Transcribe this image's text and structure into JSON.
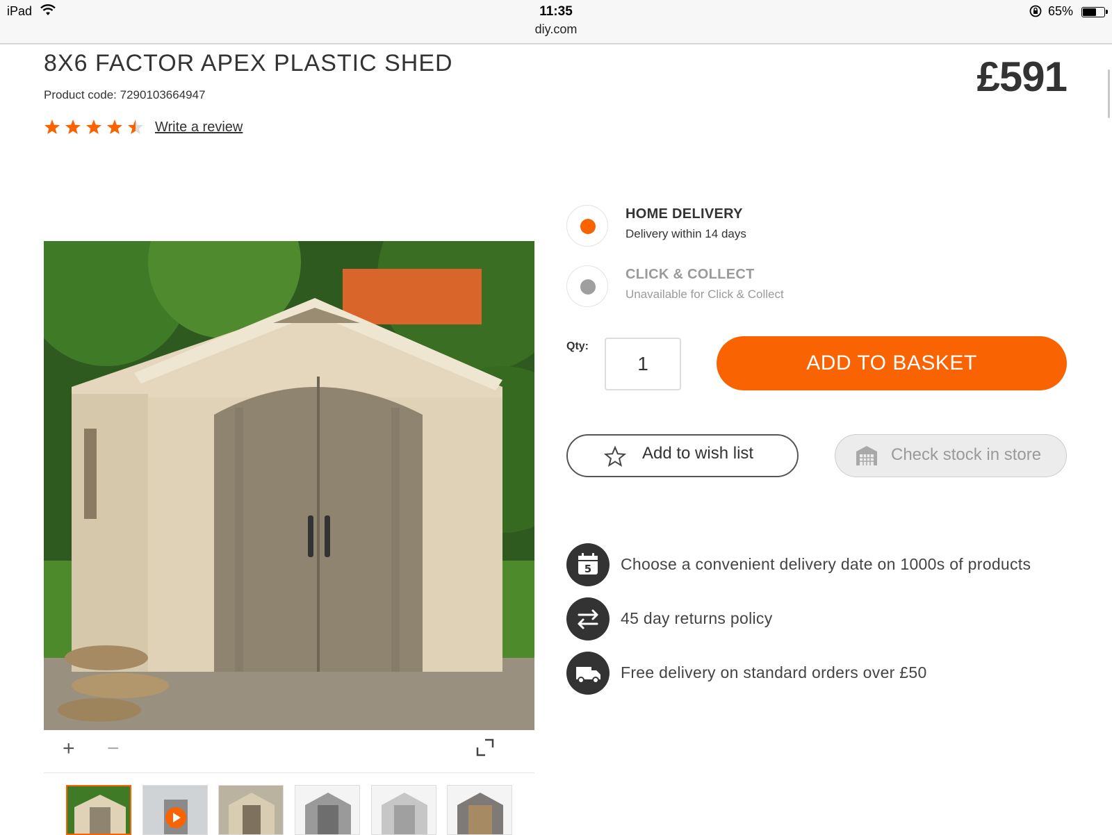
{
  "status_bar": {
    "device": "iPad",
    "time": "11:35",
    "url": "diy.com",
    "battery": "65%"
  },
  "product": {
    "title": "8X6 FACTOR APEX PLASTIC SHED",
    "code_label": "Product code:  7290103664947",
    "rating": 4.5,
    "rating_max": 5,
    "write_review": "Write a review",
    "price": "£591"
  },
  "delivery": {
    "home": {
      "title": "HOME DELIVERY",
      "subtitle": "Delivery within 14 days",
      "selected": true
    },
    "collect": {
      "title": "CLICK & COLLECT",
      "subtitle": "Unavailable for Click & Collect",
      "selected": false
    }
  },
  "purchase": {
    "qty_label": "Qty:",
    "qty_value": "1",
    "add_to_basket": "ADD TO BASKET",
    "wish_list": "Add to wish list",
    "check_stock": "Check stock in store"
  },
  "benefits": [
    {
      "icon": "calendar-icon",
      "calendar_day": "5",
      "text": "Choose a convenient delivery date on 1000s of products"
    },
    {
      "icon": "returns-arrows-icon",
      "text": "45 day returns policy"
    },
    {
      "icon": "delivery-van-icon",
      "text": "Free delivery on standard orders over £50"
    }
  ],
  "gallery": {
    "zoom_in": "+",
    "zoom_out": "−"
  },
  "colors": {
    "accent": "#f96302",
    "text": "#333333",
    "muted": "#9a9a9a"
  }
}
